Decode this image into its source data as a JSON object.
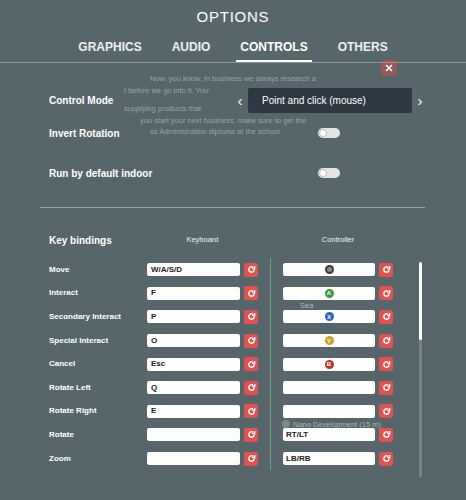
{
  "window": {
    "title": "OPTIONS"
  },
  "tabs": [
    {
      "label": "GRAPHICS",
      "selected": false
    },
    {
      "label": "AUDIO",
      "selected": false
    },
    {
      "label": "CONTROLS",
      "selected": true
    },
    {
      "label": "OTHERS",
      "selected": false
    }
  ],
  "background": {
    "tooltip_lines": [
      "Now, you know, in business we always research a",
      "t before we go into it. You'",
      "supplying products that",
      "you start your next business, make sure to get the",
      "ss Administration diploma at the school."
    ],
    "labels": [
      "Sea",
      "Nano Development (15 m)"
    ]
  },
  "settings": {
    "control_mode": {
      "label": "Control Mode",
      "value": "Point and click (mouse)",
      "prev": "‹",
      "next": "›"
    },
    "toggles": [
      {
        "label": "Invert Rotation",
        "on": false
      },
      {
        "label": "Run by default indoor",
        "on": false
      }
    ]
  },
  "key_bindings": {
    "title": "Key bindings",
    "columns": [
      "Keyboard",
      "Controller"
    ],
    "rows": [
      {
        "action": "Move",
        "keyboard": "W/A/S/D",
        "controller": {
          "kind": "stick",
          "color": "#3a3a3a"
        }
      },
      {
        "action": "Interact",
        "keyboard": "F",
        "controller": {
          "kind": "button",
          "label": "A",
          "color": "#3e9a3c"
        }
      },
      {
        "action": "Secondary Interact",
        "keyboard": "P",
        "controller": {
          "kind": "button",
          "label": "X",
          "color": "#2f62b8"
        }
      },
      {
        "action": "Special Interact",
        "keyboard": "O",
        "controller": {
          "kind": "button",
          "label": "Y",
          "color": "#c9a227"
        }
      },
      {
        "action": "Cancel",
        "keyboard": "Esc",
        "controller": {
          "kind": "button",
          "label": "B",
          "color": "#b9342c"
        }
      },
      {
        "action": "Rotate Left",
        "keyboard": "Q",
        "controller": {
          "kind": "text",
          "text": ""
        }
      },
      {
        "action": "Rotate Right",
        "keyboard": "E",
        "controller": {
          "kind": "text",
          "text": ""
        }
      },
      {
        "action": "Rotate",
        "keyboard": "",
        "controller": {
          "kind": "text",
          "text": "RT/LT"
        }
      },
      {
        "action": "Zoom",
        "keyboard": "",
        "controller": {
          "kind": "text",
          "text": "LB/RB"
        }
      }
    ]
  }
}
